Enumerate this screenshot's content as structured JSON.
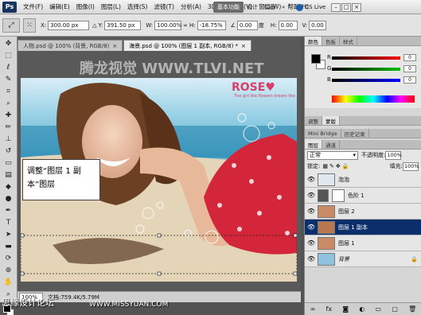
{
  "app": {
    "logo": "Ps"
  },
  "menu": [
    "文件(F)",
    "编辑(E)",
    "图像(I)",
    "图层(L)",
    "选择(S)",
    "滤镜(T)",
    "分析(A)",
    "3D(D)",
    "视图(V)",
    "窗口(W)",
    "帮助(H)"
  ],
  "workspaces": {
    "active": "基本功能",
    "items": [
      "设计",
      "绘画"
    ],
    "more": "»",
    "cslive": "CS Live"
  },
  "options": {
    "x_label": "X:",
    "x_value": "300.00 px",
    "y_label": "Y:",
    "y_value": "391.50 px",
    "w_label": "W:",
    "w_value": "100.00%",
    "h_label": "H:",
    "h_value": "-18.75%",
    "angle_value": "0.00",
    "angle_unit": "度",
    "hskew_label": "H:",
    "hskew_value": "0.00",
    "vskew_label": "V:",
    "vskew_value": "0.00"
  },
  "document": {
    "tabs": [
      {
        "label": "人物.psd @ 100% (背景, RGB/8)",
        "active": false
      },
      {
        "label": "海景.psd @ 100% (图层 1 副本, RGB/8) *",
        "active": true
      }
    ],
    "zoom": "100%",
    "status": "文档:759.4K/5.79M",
    "overlay_title": "腾龙视觉 WWW.TLVI.NET",
    "rose_text": "ROSE♥",
    "rose_sub": "The girl like flowers dream-like"
  },
  "callout": {
    "line1": "调整“图层 1 副",
    "line2": "本”图层"
  },
  "color_panel": {
    "tabs": [
      "颜色",
      "色板",
      "样式"
    ],
    "r_label": "R",
    "g_label": "G",
    "b_label": "B",
    "r_value": "0",
    "g_value": "0",
    "b_value": "0"
  },
  "adjust_tabs": [
    "调整",
    "蒙版"
  ],
  "mini_tabs": [
    "Mini Bridge",
    "历史记录"
  ],
  "layers_panel": {
    "tabs": [
      "图层",
      "通道"
    ],
    "blend_mode": "正常",
    "opacity_label": "不透明度:",
    "opacity_value": "100%",
    "lock_label": "锁定:",
    "fill_label": "填充:",
    "fill_value": "100%",
    "layers": [
      {
        "name": "泡泡",
        "selected": false,
        "thumb": "#dfe8ef"
      },
      {
        "name": "色阶 1",
        "selected": false,
        "thumb": "#555555"
      },
      {
        "name": "图层 2",
        "selected": false,
        "thumb": "#c98a66"
      },
      {
        "name": "图层 1 副本",
        "selected": true,
        "thumb": "#b9774f"
      },
      {
        "name": "图层 1",
        "selected": false,
        "thumb": "#c98a66"
      },
      {
        "name": "背景",
        "selected": false,
        "thumb": "#8fc3dd"
      }
    ]
  },
  "watermarks": {
    "left": "思缘设计论坛",
    "mid": "WWW.MISSYUAN.COM"
  },
  "colors": {
    "selected_layer": "#0a2f6b",
    "panel_bg": "#d6d6d6"
  }
}
